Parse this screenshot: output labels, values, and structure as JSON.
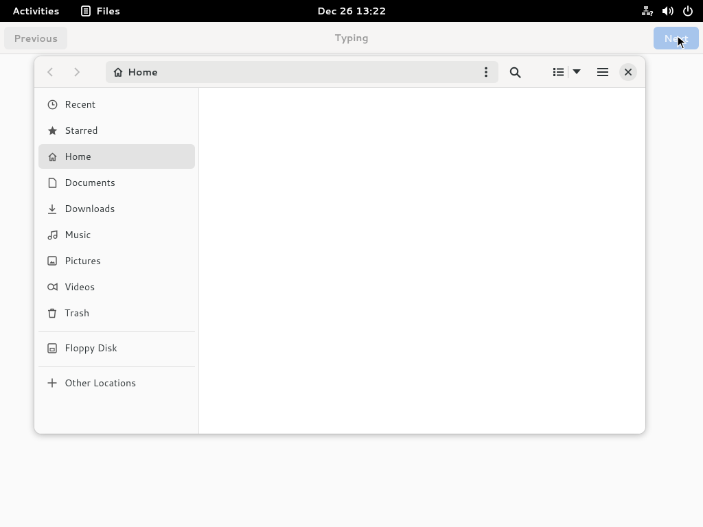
{
  "topbar": {
    "activities": "Activities",
    "app_name": "Files",
    "clock": "Dec 26  13:22",
    "tray_icons": [
      "network-question-icon",
      "volume-icon",
      "power-icon"
    ]
  },
  "tutorial": {
    "previous_label": "Previous",
    "title": "Typing",
    "next_label": "Next"
  },
  "files": {
    "path_label": "Home",
    "sidebar": {
      "items": [
        {
          "label": "Recent",
          "icon": "clock-icon"
        },
        {
          "label": "Starred",
          "icon": "star-icon"
        },
        {
          "label": "Home",
          "icon": "home-icon",
          "active": true
        },
        {
          "label": "Documents",
          "icon": "document-icon"
        },
        {
          "label": "Downloads",
          "icon": "download-icon"
        },
        {
          "label": "Music",
          "icon": "music-icon"
        },
        {
          "label": "Pictures",
          "icon": "picture-icon"
        },
        {
          "label": "Videos",
          "icon": "video-icon"
        },
        {
          "label": "Trash",
          "icon": "trash-icon"
        }
      ],
      "devices": [
        {
          "label": "Floppy Disk",
          "icon": "floppy-icon"
        }
      ],
      "other": [
        {
          "label": "Other Locations",
          "icon": "plus-icon"
        }
      ]
    }
  },
  "colors": {
    "topbar_bg": "#000000",
    "next_button_bg": "#a7c5ec",
    "sidebar_active_bg": "#e3e3e3"
  }
}
